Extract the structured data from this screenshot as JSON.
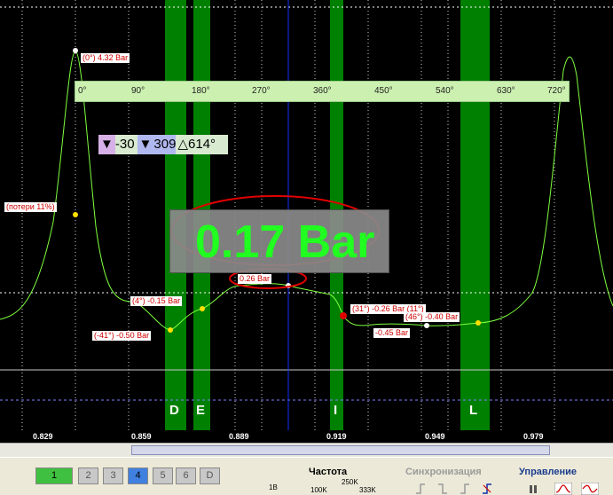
{
  "plot": {
    "degree_ruler": [
      "0°",
      "90°",
      "180°",
      "270°",
      "360°",
      "450°",
      "540°",
      "630°",
      "720°"
    ],
    "toolbar_mini": {
      "a": "-30",
      "b": "309",
      "c": "614°"
    },
    "big_value": "0.17 Bar",
    "markers": [
      {
        "text": "(0°) 4.32 Bar"
      },
      {
        "text": "(потери 11%)"
      },
      {
        "text": "(4°) -0.15 Bar"
      },
      {
        "text": "(-41°) -0.50 Bar"
      },
      {
        "text": "0.26 Bar"
      },
      {
        "text": "(31°) -0.26 Bar (11°)"
      },
      {
        "text": "(46°) -0.40 Bar"
      },
      {
        "text": "-0.45 Bar"
      }
    ],
    "band_letters": [
      "D",
      "E",
      "I",
      "L"
    ],
    "time_labels": [
      "0.829",
      "0.859",
      "0.889",
      "0.919",
      "0.949",
      "0.979"
    ],
    "colors": {
      "trace": "#7fff3f",
      "band": "#008000",
      "marker_text": "#d00000",
      "circle": "#e00000",
      "cursor": "#1030ff"
    }
  },
  "panel": {
    "channels": [
      "1",
      "2",
      "3",
      "4",
      "5",
      "6",
      "D"
    ],
    "frequency": {
      "title": "Частота",
      "value_top": "250K",
      "value_left": "100K",
      "value_right": "333K"
    },
    "sync": {
      "title": "Синхронизация"
    },
    "control": {
      "title": "Управление"
    },
    "range_label": "1В"
  }
}
